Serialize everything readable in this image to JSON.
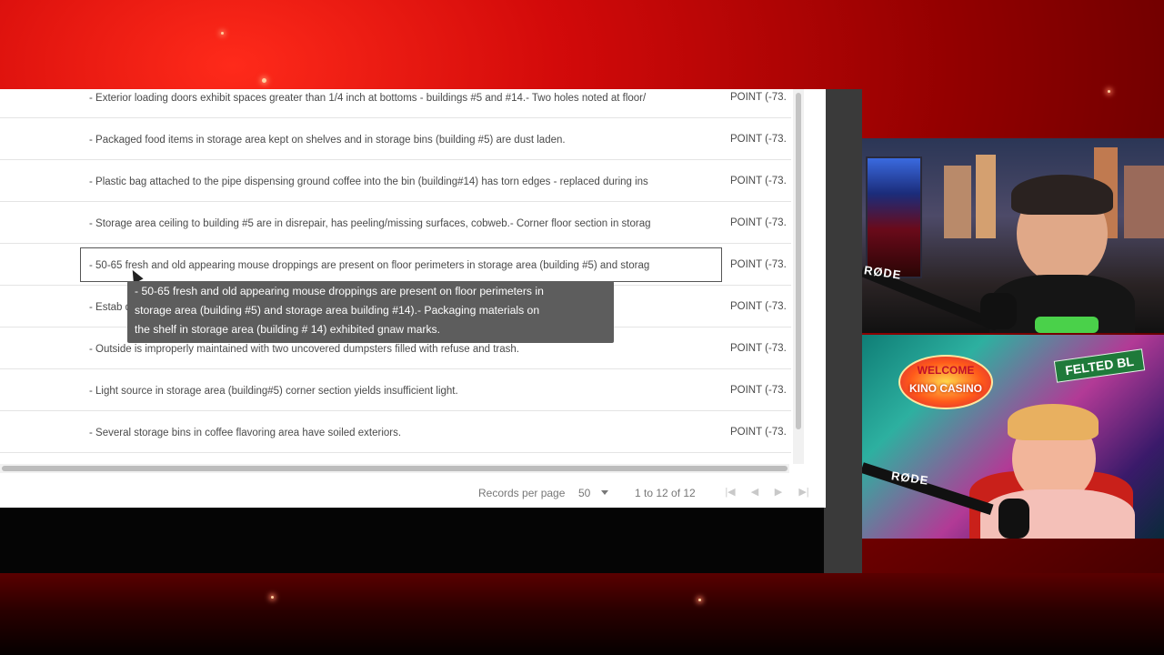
{
  "table": {
    "rows": [
      {
        "description": "- Exterior loading doors exhibit spaces greater than 1/4 inch at bottoms - buildings #5 and #14.- Two holes noted at floor/",
        "location": "POINT (-73."
      },
      {
        "description": "- Packaged food items in storage area kept on shelves and in storage bins (building #5) are dust laden.",
        "location": "POINT (-73."
      },
      {
        "description": "- Plastic bag attached to the pipe dispensing ground coffee into the bin (building#14) has torn edges - replaced during ins",
        "location": "POINT (-73."
      },
      {
        "description": "- Storage area ceiling to building #5 are in disrepair, has peeling/missing surfaces, cobweb.- Corner floor section in storag",
        "location": "POINT (-73."
      },
      {
        "description": "- 50-65 fresh and old appearing mouse droppings are present on floor perimeters in storage area (building #5) and storag",
        "location": "POINT (-73.",
        "selected": true
      },
      {
        "description": "- Estab                                                                                                                          d items stored directl",
        "location": "POINT (-73."
      },
      {
        "description": "- Outside is improperly maintained with two uncovered dumpsters filled with refuse and trash.",
        "location": "POINT (-73."
      },
      {
        "description": "- Light source in storage area (building#5) corner section yields insufficient light.",
        "location": "POINT (-73."
      },
      {
        "description": "- Several storage bins in coffee flavoring area have soiled exteriors.",
        "location": "POINT (-73."
      }
    ]
  },
  "tooltip": {
    "lines": [
      "- 50-65 fresh and old appearing mouse droppings are present on floor perimeters in",
      "storage area (building #5) and storage area building #14).- Packaging materials on",
      "the shelf in storage area (building # 14) exhibited gnaw marks."
    ]
  },
  "pager": {
    "records_label": "Records per page",
    "per_page": "50",
    "range": "1 to 12 of 12",
    "icons": [
      "first-page-icon",
      "prev-page-icon",
      "next-page-icon",
      "last-page-icon"
    ]
  },
  "overlay": {
    "cam1_mic_brand": "RØDE",
    "cam2_mic_brand": "RØDE",
    "sign_top": "WELCOME",
    "sign_bottom": "KINO CASINO",
    "street_sign": "FELTED BL"
  },
  "colors": {
    "background_red": "#d40a0a",
    "tooltip_bg": "#5d5d5d"
  }
}
